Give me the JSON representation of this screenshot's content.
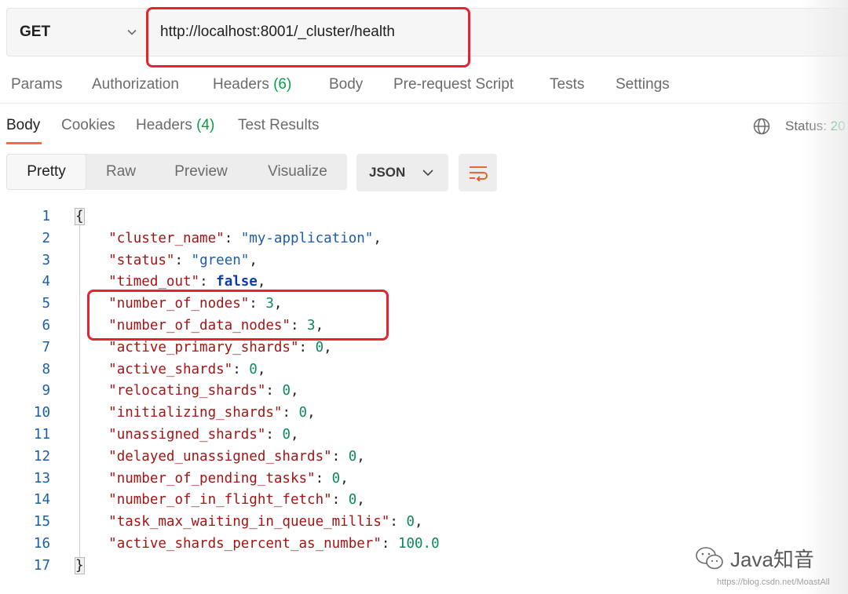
{
  "request": {
    "method": "GET",
    "url": "http://localhost:8001/_cluster/health"
  },
  "request_tabs": [
    {
      "label": "Params",
      "count": ""
    },
    {
      "label": "Authorization",
      "count": ""
    },
    {
      "label": "Headers",
      "count": "(6)"
    },
    {
      "label": "Body",
      "count": ""
    },
    {
      "label": "Pre-request Script",
      "count": ""
    },
    {
      "label": "Tests",
      "count": ""
    },
    {
      "label": "Settings",
      "count": ""
    }
  ],
  "response_tabs": [
    {
      "label": "Body",
      "count": "",
      "active": true
    },
    {
      "label": "Cookies",
      "count": ""
    },
    {
      "label": "Headers",
      "count": "(4)"
    },
    {
      "label": "Test Results",
      "count": ""
    }
  ],
  "status": {
    "label": "Status:",
    "value": "20",
    "icon": "globe-icon"
  },
  "view_modes": [
    "Pretty",
    "Raw",
    "Preview",
    "Visualize"
  ],
  "active_view": "Pretty",
  "format": {
    "label": "JSON",
    "icon": "chevron-down-icon"
  },
  "wrap_icon": "wrap-lines-icon",
  "code": {
    "lines": [
      {
        "n": "1",
        "t": "{"
      },
      {
        "n": "2",
        "k": "cluster_name",
        "v": "\"my-application\"",
        "vt": "s",
        "c": ","
      },
      {
        "n": "3",
        "k": "status",
        "v": "\"green\"",
        "vt": "s",
        "c": ","
      },
      {
        "n": "4",
        "k": "timed_out",
        "v": "false",
        "vt": "b",
        "c": ","
      },
      {
        "n": "5",
        "k": "number_of_nodes",
        "v": "3",
        "vt": "n",
        "c": ","
      },
      {
        "n": "6",
        "k": "number_of_data_nodes",
        "v": "3",
        "vt": "n",
        "c": ","
      },
      {
        "n": "7",
        "k": "active_primary_shards",
        "v": "0",
        "vt": "n",
        "c": ","
      },
      {
        "n": "8",
        "k": "active_shards",
        "v": "0",
        "vt": "n",
        "c": ","
      },
      {
        "n": "9",
        "k": "relocating_shards",
        "v": "0",
        "vt": "n",
        "c": ","
      },
      {
        "n": "10",
        "k": "initializing_shards",
        "v": "0",
        "vt": "n",
        "c": ","
      },
      {
        "n": "11",
        "k": "unassigned_shards",
        "v": "0",
        "vt": "n",
        "c": ","
      },
      {
        "n": "12",
        "k": "delayed_unassigned_shards",
        "v": "0",
        "vt": "n",
        "c": ","
      },
      {
        "n": "13",
        "k": "number_of_pending_tasks",
        "v": "0",
        "vt": "n",
        "c": ","
      },
      {
        "n": "14",
        "k": "number_of_in_flight_fetch",
        "v": "0",
        "vt": "n",
        "c": ","
      },
      {
        "n": "15",
        "k": "task_max_waiting_in_queue_millis",
        "v": "0",
        "vt": "n",
        "c": ","
      },
      {
        "n": "16",
        "k": "active_shards_percent_as_number",
        "v": "100.0",
        "vt": "n",
        "c": ""
      },
      {
        "n": "17",
        "t": "}"
      }
    ]
  },
  "watermark": {
    "text": "Java知音",
    "url": "https://blog.csdn.net/MoastAll"
  }
}
